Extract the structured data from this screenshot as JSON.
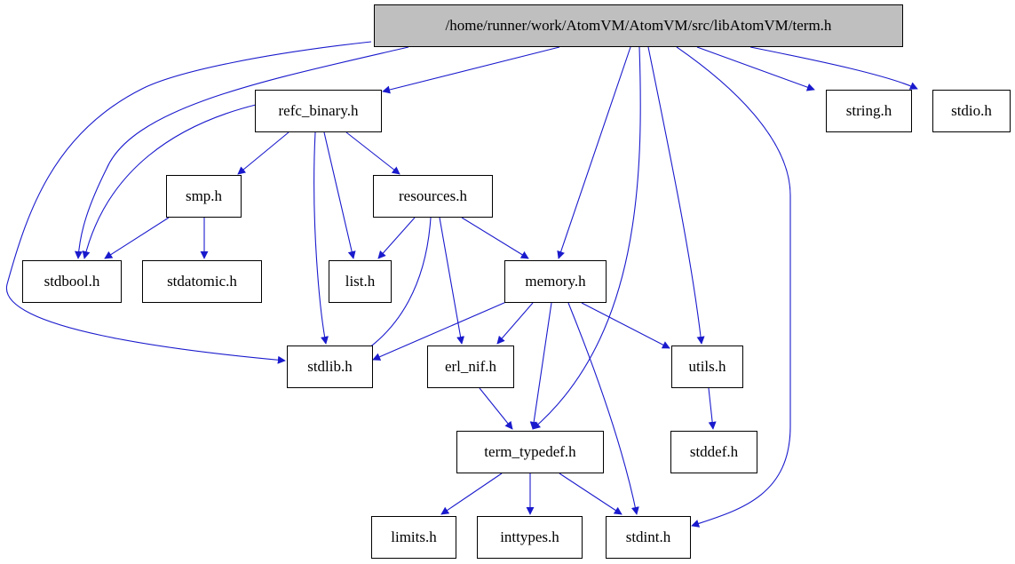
{
  "graph": {
    "edge_color": "#1a1acd",
    "root_fill": "#bfbfbf",
    "nodes": [
      {
        "id": "term",
        "label": "/home/runner/work/AtomVM/AtomVM/src/libAtomVM/term.h",
        "root": true
      },
      {
        "id": "refc_binary",
        "label": "refc_binary.h"
      },
      {
        "id": "string",
        "label": "string.h"
      },
      {
        "id": "stdio",
        "label": "stdio.h"
      },
      {
        "id": "smp",
        "label": "smp.h"
      },
      {
        "id": "resources",
        "label": "resources.h"
      },
      {
        "id": "stdbool",
        "label": "stdbool.h"
      },
      {
        "id": "stdatomic",
        "label": "stdatomic.h"
      },
      {
        "id": "list",
        "label": "list.h"
      },
      {
        "id": "memory",
        "label": "memory.h"
      },
      {
        "id": "stdlib",
        "label": "stdlib.h"
      },
      {
        "id": "erl_nif",
        "label": "erl_nif.h"
      },
      {
        "id": "utils",
        "label": "utils.h"
      },
      {
        "id": "term_typedef",
        "label": "term_typedef.h"
      },
      {
        "id": "stddef",
        "label": "stddef.h"
      },
      {
        "id": "limits",
        "label": "limits.h"
      },
      {
        "id": "inttypes",
        "label": "inttypes.h"
      },
      {
        "id": "stdint",
        "label": "stdint.h"
      }
    ],
    "edges": [
      {
        "from": "term",
        "to": "stdbool"
      },
      {
        "from": "term",
        "to": "stdlib"
      },
      {
        "from": "term",
        "to": "refc_binary"
      },
      {
        "from": "term",
        "to": "memory"
      },
      {
        "from": "term",
        "to": "term_typedef"
      },
      {
        "from": "term",
        "to": "utils"
      },
      {
        "from": "term",
        "to": "stdint"
      },
      {
        "from": "term",
        "to": "string"
      },
      {
        "from": "term",
        "to": "stdio"
      },
      {
        "from": "refc_binary",
        "to": "stdbool"
      },
      {
        "from": "refc_binary",
        "to": "smp"
      },
      {
        "from": "refc_binary",
        "to": "stdlib"
      },
      {
        "from": "refc_binary",
        "to": "list"
      },
      {
        "from": "refc_binary",
        "to": "resources"
      },
      {
        "from": "smp",
        "to": "stdbool"
      },
      {
        "from": "smp",
        "to": "stdatomic"
      },
      {
        "from": "resources",
        "to": "list"
      },
      {
        "from": "resources",
        "to": "stdlib"
      },
      {
        "from": "resources",
        "to": "erl_nif"
      },
      {
        "from": "resources",
        "to": "memory"
      },
      {
        "from": "memory",
        "to": "stdlib"
      },
      {
        "from": "memory",
        "to": "erl_nif"
      },
      {
        "from": "memory",
        "to": "term_typedef"
      },
      {
        "from": "memory",
        "to": "stdint"
      },
      {
        "from": "memory",
        "to": "utils"
      },
      {
        "from": "erl_nif",
        "to": "term_typedef"
      },
      {
        "from": "utils",
        "to": "stddef"
      },
      {
        "from": "term_typedef",
        "to": "limits"
      },
      {
        "from": "term_typedef",
        "to": "inttypes"
      },
      {
        "from": "term_typedef",
        "to": "stdint"
      }
    ]
  }
}
